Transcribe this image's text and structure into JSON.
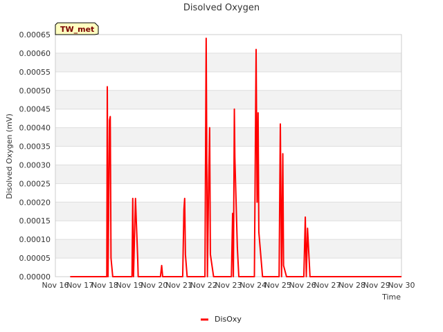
{
  "chart_data": {
    "type": "line",
    "title": "Disolved Oxygen",
    "xlabel": "Time",
    "ylabel": "Disolved Oxygen (mV)",
    "badge": "TW_met",
    "ylim": [
      0,
      0.00065
    ],
    "y_ticks": [
      "0.00000",
      "0.00005",
      "0.00010",
      "0.00015",
      "0.00020",
      "0.00025",
      "0.00030",
      "0.00035",
      "0.00040",
      "0.00045",
      "0.00050",
      "0.00055",
      "0.00060",
      "0.00065"
    ],
    "xlim": [
      16,
      30
    ],
    "x_ticks": [
      {
        "v": 16,
        "label": "Nov 16"
      },
      {
        "v": 17,
        "label": "Nov 17"
      },
      {
        "v": 18,
        "label": "Nov 18"
      },
      {
        "v": 19,
        "label": "Nov 19"
      },
      {
        "v": 20,
        "label": "Nov 20"
      },
      {
        "v": 21,
        "label": "Nov 21"
      },
      {
        "v": 22,
        "label": "Nov 22"
      },
      {
        "v": 23,
        "label": "Nov 23"
      },
      {
        "v": 24,
        "label": "Nov 24"
      },
      {
        "v": 25,
        "label": "Nov 25"
      },
      {
        "v": 26,
        "label": "Nov 26"
      },
      {
        "v": 27,
        "label": "Nov 27"
      },
      {
        "v": 28,
        "label": "Nov 28"
      },
      {
        "v": 29,
        "label": "Nov 29"
      },
      {
        "v": 30,
        "label": "Nov 30"
      }
    ],
    "grid": true,
    "legend_position": "bottom-center",
    "colors": {
      "line": "#ff0000",
      "band": "#f2f2f2",
      "grid": "#dddddd",
      "badge_bg": "#ffffc0"
    },
    "series": [
      {
        "name": "DisOxy",
        "points": [
          [
            16.6,
            0
          ],
          [
            18.0,
            0
          ],
          [
            18.08,
            0
          ],
          [
            18.1,
            0.00051
          ],
          [
            18.13,
            0
          ],
          [
            18.19,
            0.00042
          ],
          [
            18.22,
            0.00043
          ],
          [
            18.25,
            5e-05
          ],
          [
            18.32,
            0
          ],
          [
            19.1,
            0
          ],
          [
            19.13,
            0.00021
          ],
          [
            19.16,
            0
          ],
          [
            19.24,
            0.00021
          ],
          [
            19.33,
            5e-05
          ],
          [
            19.35,
            0
          ],
          [
            20.25,
            0
          ],
          [
            20.3,
            3e-05
          ],
          [
            20.34,
            0
          ],
          [
            21.15,
            0
          ],
          [
            21.2,
            0.00018
          ],
          [
            21.23,
            0.00021
          ],
          [
            21.26,
            6e-05
          ],
          [
            21.33,
            0
          ],
          [
            22.05,
            0
          ],
          [
            22.1,
            0.00064
          ],
          [
            22.15,
            0
          ],
          [
            22.2,
            0.00025
          ],
          [
            22.24,
            0.0004
          ],
          [
            22.27,
            6e-05
          ],
          [
            22.4,
            0
          ],
          [
            23.12,
            0
          ],
          [
            23.17,
            0.00017
          ],
          [
            23.2,
            0
          ],
          [
            23.24,
            0.00045
          ],
          [
            23.26,
            0.00032
          ],
          [
            23.36,
            8e-05
          ],
          [
            23.42,
            0
          ],
          [
            24.05,
            0
          ],
          [
            24.12,
            0.00061
          ],
          [
            24.16,
            0.0002
          ],
          [
            24.2,
            0.00044
          ],
          [
            24.23,
            0.00012
          ],
          [
            24.38,
            0
          ],
          [
            25.05,
            0
          ],
          [
            25.1,
            0.00041
          ],
          [
            25.15,
            0
          ],
          [
            25.2,
            0.00033
          ],
          [
            25.23,
            3e-05
          ],
          [
            25.35,
            0
          ],
          [
            26.05,
            0
          ],
          [
            26.11,
            0.00016
          ],
          [
            26.15,
            0
          ],
          [
            26.2,
            0.00013
          ],
          [
            26.3,
            0
          ],
          [
            30,
            0
          ]
        ]
      }
    ]
  }
}
